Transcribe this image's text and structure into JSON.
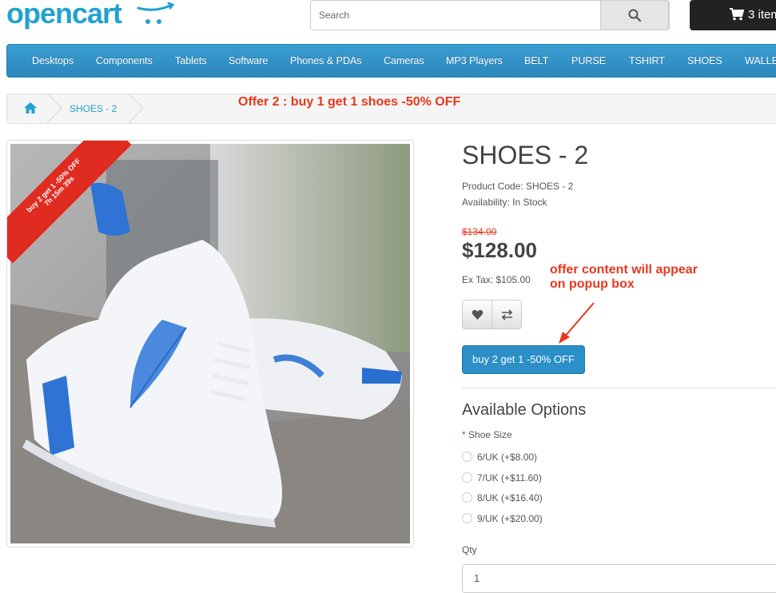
{
  "header": {
    "logo_text": "opencart",
    "search_placeholder": "Search",
    "cart_label": "3 item"
  },
  "menu": {
    "items": [
      "Desktops",
      "Components",
      "Tablets",
      "Software",
      "Phones & PDAs",
      "Cameras",
      "MP3 Players",
      "BELT",
      "PURSE",
      "TSHIRT",
      "SHOES",
      "WALLET"
    ]
  },
  "breadcrumb": {
    "current": "SHOES - 2"
  },
  "annotations": {
    "offer_note": "Offer 2 : buy 1 get 1 shoes -50% OFF",
    "popup_note_line1": "offer content will appear",
    "popup_note_line2": "on popup box"
  },
  "ribbon": {
    "line1": "buy 2 get 1 -50% OFF",
    "line2": "7h 15m 39s"
  },
  "product": {
    "title": "SHOES - 2",
    "product_code": "Product Code: SHOES - 2",
    "availability": "Availability: In Stock",
    "old_price": "$134.00",
    "price": "$128.00",
    "ex_tax": "Ex Tax: $105.00",
    "offer_button": "buy 2 get 1 -50% OFF"
  },
  "options": {
    "title": "Available Options",
    "required_star": "*",
    "shoe_size_label": "Shoe Size",
    "sizes": [
      "6/UK (+$8.00)",
      "7/UK (+$11.60)",
      "8/UK (+$16.40)",
      "9/UK (+$20.00)"
    ],
    "qty_label": "Qty",
    "qty_value": "1"
  },
  "colors": {
    "brand_blue": "#23a1d1",
    "menu_blue": "#2c86bb",
    "annotation_red": "#e8371d",
    "ribbon_red": "#e02b20"
  }
}
